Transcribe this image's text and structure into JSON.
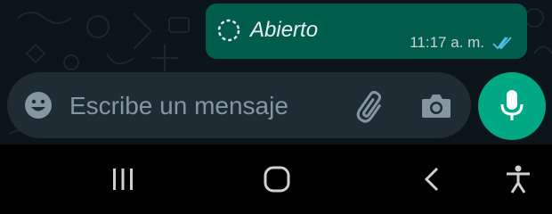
{
  "chat": {
    "message": {
      "text": "Abierto",
      "time": "11:17 a. m.",
      "status_icon": "double-check-icon",
      "type_icon": "view-once-icon"
    }
  },
  "composer": {
    "placeholder": "Escribe un mensaje",
    "emoji_icon": "emoji-icon",
    "attach_icon": "paperclip-icon",
    "camera_icon": "camera-icon",
    "mic_icon": "mic-icon"
  },
  "navigation": {
    "recents_icon": "recents-icon",
    "home_icon": "home-icon",
    "back_icon": "back-icon",
    "accessibility_icon": "accessibility-icon"
  },
  "colors": {
    "chat_background": "#0b141a",
    "outgoing_bubble": "#005c4b",
    "input_bar": "#1f2c34",
    "accent": "#00a884",
    "read_ticks": "#53bdeb",
    "placeholder_text": "#8696a0"
  }
}
